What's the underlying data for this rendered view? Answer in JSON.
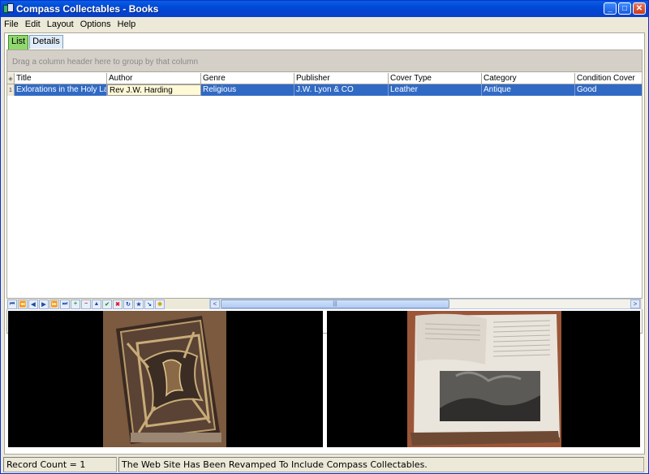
{
  "window": {
    "title": "Compass Collectables - Books",
    "min_label": "_",
    "max_label": "□",
    "close_label": "✕"
  },
  "menu": [
    "File",
    "Edit",
    "Layout",
    "Options",
    "Help"
  ],
  "tabs": [
    {
      "label": "List",
      "active": true
    },
    {
      "label": "Details",
      "active": false
    }
  ],
  "grid": {
    "group_hint": "Drag a column header here to group by that column",
    "columns": [
      "Title",
      "Author",
      "Genre",
      "Publisher",
      "Cover Type",
      "Category",
      "Condition Cover"
    ],
    "rows": [
      {
        "index": "1",
        "cells": [
          "Exlorations in the Holy Land",
          "Rev J.W. Harding",
          "Religious",
          "J.W. Lyon & CO",
          "Leather",
          "Antique",
          "Good"
        ]
      }
    ]
  },
  "navigator": {
    "buttons": [
      {
        "name": "first-page-button",
        "glyph": "⏮",
        "tone": ""
      },
      {
        "name": "prev-page-button",
        "glyph": "⏪",
        "tone": ""
      },
      {
        "name": "prev-record-button",
        "glyph": "◀",
        "tone": ""
      },
      {
        "name": "next-record-button",
        "glyph": "▶",
        "tone": ""
      },
      {
        "name": "next-page-button",
        "glyph": "⏩",
        "tone": ""
      },
      {
        "name": "last-page-button",
        "glyph": "⏭",
        "tone": ""
      },
      {
        "name": "add-record-button",
        "glyph": "+",
        "tone": "g"
      },
      {
        "name": "delete-record-button",
        "glyph": "−",
        "tone": "r"
      },
      {
        "name": "edit-record-button",
        "glyph": "▲",
        "tone": ""
      },
      {
        "name": "post-edit-button",
        "glyph": "✔",
        "tone": "g"
      },
      {
        "name": "cancel-edit-button",
        "glyph": "✖",
        "tone": "r"
      },
      {
        "name": "refresh-button",
        "glyph": "↻",
        "tone": ""
      },
      {
        "name": "bookmark-button",
        "glyph": "★",
        "tone": ""
      },
      {
        "name": "goto-bookmark-button",
        "glyph": "↘",
        "tone": ""
      },
      {
        "name": "filter-button",
        "glyph": "✱",
        "tone": "y"
      }
    ],
    "scroll_left": "<",
    "scroll_right": ">",
    "scroll_grip": "|||"
  },
  "status": {
    "record_count": "Record Count = 1",
    "message": "The Web Site Has Been Revamped To Include Compass Collectables."
  }
}
